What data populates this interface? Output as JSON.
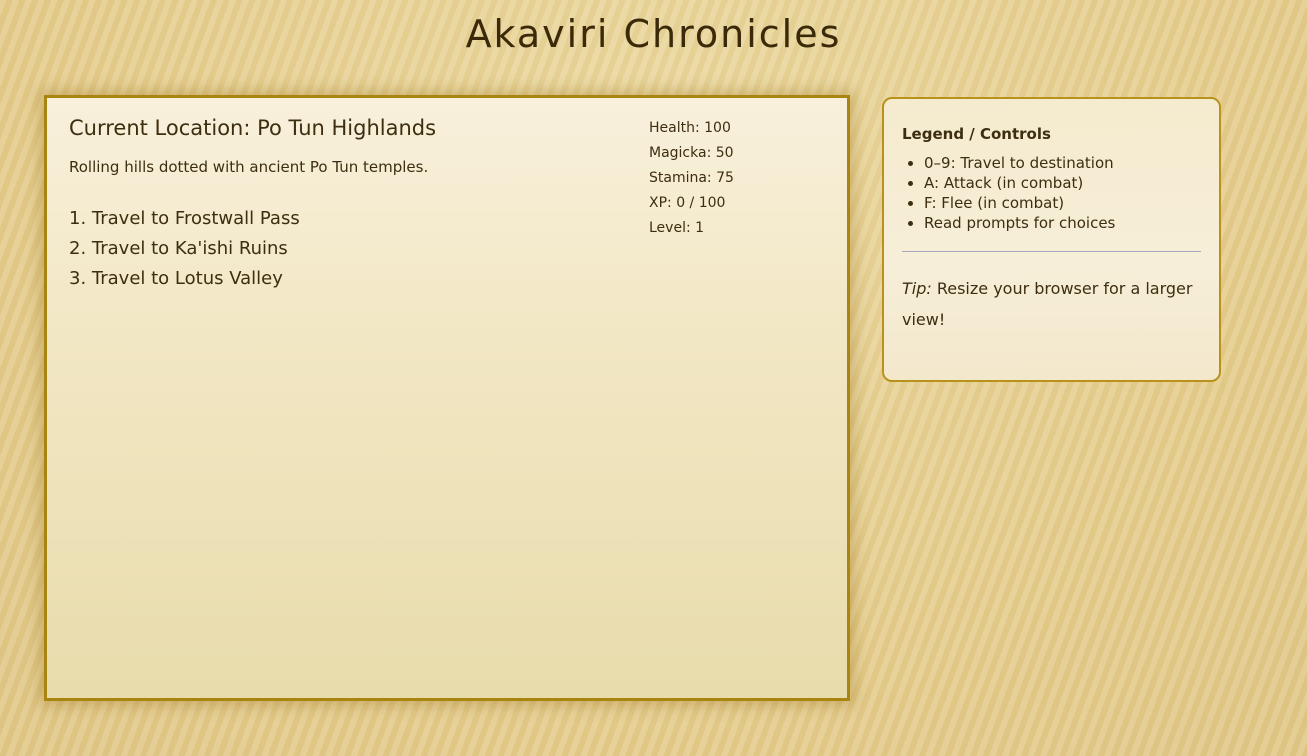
{
  "app": {
    "title": "Akaviri Chronicles"
  },
  "location": {
    "title": "Current Location: Po Tun Highlands",
    "description": "Rolling hills dotted with ancient Po Tun temples."
  },
  "destinations": [
    "1. Travel to Frostwall Pass",
    "2. Travel to Ka'ishi Ruins",
    "3. Travel to Lotus Valley"
  ],
  "stats": {
    "health": "Health: 100",
    "magicka": "Magicka: 50",
    "stamina": "Stamina: 75",
    "xp": "XP: 0 / 100",
    "level": "Level: 1"
  },
  "legend": {
    "title": "Legend / Controls",
    "items": [
      "0–9: Travel to destination",
      "A: Attack (in combat)",
      "F: Flee (in combat)",
      "Read prompts for choices"
    ],
    "tip_label": "Tip:",
    "tip_text": " Resize your browser for a larger view!"
  },
  "colors": {
    "background": "#e8d396",
    "panel_border": "#a88410",
    "text": "#3d2e10"
  }
}
